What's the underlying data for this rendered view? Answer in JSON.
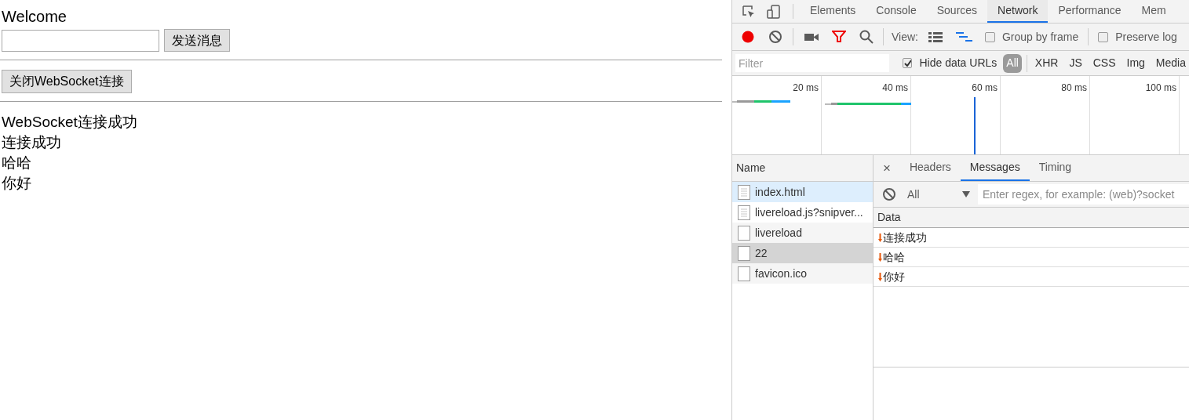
{
  "page": {
    "heading": "Welcome",
    "send_button": "发送消息",
    "close_button": "关闭WebSocket连接",
    "log": [
      "WebSocket连接成功",
      "连接成功",
      "哈哈",
      "你好"
    ]
  },
  "devtools": {
    "tabs": [
      {
        "label": "Elements",
        "selected": false
      },
      {
        "label": "Console",
        "selected": false
      },
      {
        "label": "Sources",
        "selected": false
      },
      {
        "label": "Network",
        "selected": true
      },
      {
        "label": "Performance",
        "selected": false
      },
      {
        "label": "Mem",
        "selected": false
      }
    ],
    "toolbar": {
      "recording": true,
      "view_label": "View:",
      "waterfall_view": true,
      "checkboxes": [
        {
          "label": "Group by frame",
          "checked": false
        },
        {
          "label": "Preserve log",
          "checked": false
        }
      ]
    },
    "filter_bar": {
      "placeholder": "Filter",
      "hide_data_urls": {
        "label": "Hide data URLs",
        "checked": true
      },
      "types": [
        {
          "label": "All",
          "selected": true
        },
        {
          "label": "XHR",
          "selected": false
        },
        {
          "label": "JS",
          "selected": false
        },
        {
          "label": "CSS",
          "selected": false
        },
        {
          "label": "Img",
          "selected": false
        },
        {
          "label": "Media",
          "selected": false
        }
      ]
    },
    "timeline": {
      "ticks": [
        "20 ms",
        "40 ms",
        "60 ms",
        "80 ms",
        "100 ms"
      ]
    },
    "requests": {
      "column": "Name",
      "rows": [
        {
          "name": "index.html",
          "kind": "document",
          "selected": false,
          "hovered": true
        },
        {
          "name": "livereload.js?snipver...",
          "kind": "document",
          "selected": false,
          "hovered": false
        },
        {
          "name": "livereload",
          "kind": "blank",
          "selected": false,
          "hovered": false
        },
        {
          "name": "22",
          "kind": "blank",
          "selected": true,
          "hovered": false
        },
        {
          "name": "favicon.ico",
          "kind": "blank",
          "selected": false,
          "hovered": false
        }
      ]
    },
    "detail": {
      "close": "×",
      "tabs": [
        {
          "label": "Headers",
          "selected": false
        },
        {
          "label": "Messages",
          "selected": true
        },
        {
          "label": "Timing",
          "selected": false
        }
      ],
      "message_filter": {
        "type": "All",
        "placeholder": "Enter regex, for example: (web)?socket"
      },
      "column": "Data",
      "messages": [
        {
          "received": true,
          "text": "连接成功"
        },
        {
          "received": true,
          "text": "哈哈"
        },
        {
          "received": true,
          "text": "你好"
        }
      ]
    }
  }
}
